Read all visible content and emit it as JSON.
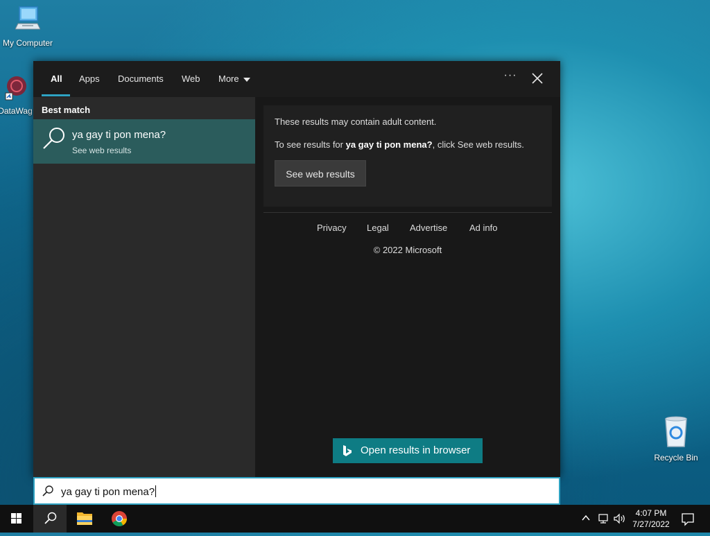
{
  "desktop": {
    "icons": [
      {
        "label": "My Computer"
      },
      {
        "label": "DataWag"
      },
      {
        "label": "Recycle Bin"
      }
    ]
  },
  "search_panel": {
    "tabs": [
      {
        "label": "All",
        "active": true
      },
      {
        "label": "Apps"
      },
      {
        "label": "Documents"
      },
      {
        "label": "Web"
      },
      {
        "label": "More"
      }
    ],
    "ellipsis": "···",
    "best_match_heading": "Best match",
    "best_match": {
      "title": "ya gay ti pon mena?",
      "subtitle": "See web results"
    },
    "warning": {
      "line1": "These results may contain adult content.",
      "line2_prefix": "To see results for ",
      "line2_query": "ya gay ti pon mena?",
      "line2_suffix": ", click See web results.",
      "button": "See web results"
    },
    "footer_links": [
      "Privacy",
      "Legal",
      "Advertise",
      "Ad info"
    ],
    "copyright": "© 2022 Microsoft",
    "open_browser_button": "Open results in browser"
  },
  "search_box": {
    "value": "ya gay ti pon mena?"
  },
  "taskbar": {
    "clock_time": "4:07 PM",
    "clock_date": "7/27/2022"
  },
  "colors": {
    "accent": "#2ea3c3",
    "best_match_bg": "#2b5c5c",
    "open_browser_bg": "#0e7c84"
  }
}
